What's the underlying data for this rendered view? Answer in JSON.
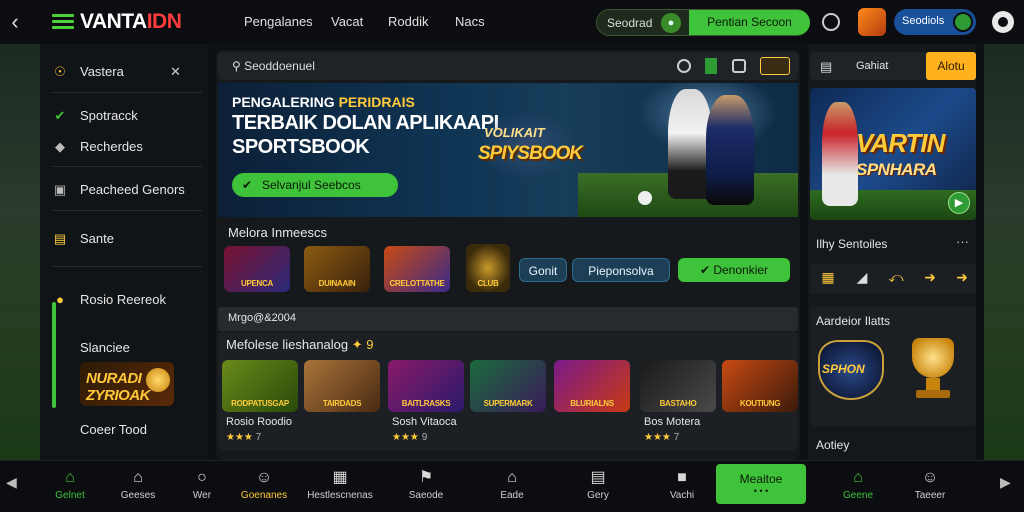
{
  "topbar": {
    "brand_main": "VANTA",
    "brand_accent": "IDN",
    "nav": [
      "Pengalanes",
      "Vacat",
      "Roddik",
      "Nacs"
    ],
    "search_label": "Seodrad",
    "search_cta": "Pentian Secoon",
    "account_label": "Seodiols",
    "icons": [
      "back-arrow-icon",
      "menu-icon",
      "clock-icon",
      "trophy-icon",
      "settings-icon"
    ]
  },
  "sidebar": {
    "items": [
      {
        "label": "Vastera",
        "icon": "ball-icon"
      },
      {
        "label": "Spotracck",
        "icon": "check-circle-icon"
      },
      {
        "label": "Recherdes",
        "icon": "diamond-icon"
      },
      {
        "label": "Peacheed Genors",
        "icon": "box-icon"
      },
      {
        "label": "Sante",
        "icon": "folder-icon"
      },
      {
        "label": "Rosio Reereok",
        "icon": "coin-icon"
      },
      {
        "label": "Slanciee",
        "icon": "star-icon"
      },
      {
        "label": "Coeer Tood",
        "icon": "list-icon"
      }
    ],
    "promo_text": "NURADI ZYRIOAK"
  },
  "main": {
    "search_query": "Seoddoenuel",
    "hero": {
      "kicker": "PENGALERING",
      "kicker_accent": "PERIDRAIS",
      "headline_1": "TERBAIK DOLAN APLIKAAPI",
      "headline_2": "SPORTSBOOK",
      "cta": "Selvanjul Seebcos",
      "emblem_top": "VOLIKAIT",
      "emblem_bottom": "SPIYSBOOK"
    },
    "featured": {
      "title": "Melora Inmeescs",
      "thumbs": [
        "UPENCA",
        "DUINAAIN",
        "CRELOTTATHE",
        "CLUB"
      ],
      "chips": [
        "Gonit",
        "Pieponsolva",
        "Denonkier"
      ]
    },
    "strip_label": "Mrgo@&2004",
    "games": {
      "title": "Mefolese lieshanalog",
      "count": "9",
      "items": [
        {
          "thumb": "RODPATUSGAP",
          "name": "Rosio Roodio",
          "rating": "7"
        },
        {
          "thumb": "TAIRDADS",
          "name": "",
          "rating": ""
        },
        {
          "thumb": "BAITLRASKS",
          "name": "Sosh Vitaoca",
          "rating": "9"
        },
        {
          "thumb": "SUPERMARK",
          "name": "",
          "rating": ""
        },
        {
          "thumb": "BLURIALNS",
          "name": "",
          "rating": ""
        },
        {
          "thumb": "BASTAHO",
          "name": "Bos Motera",
          "rating": "7"
        },
        {
          "thumb": "KOUTIUNG",
          "name": "",
          "rating": ""
        }
      ]
    }
  },
  "right": {
    "login_label": "Gahiat",
    "login_button": "Alotu",
    "promo_line_1": "VARTIN",
    "promo_line_2": "SPNHARA",
    "section_1": "Ilhy Sentoiles",
    "section_2": "Aardeior Ilatts",
    "section_3": "Aotiey",
    "trophy_text": "SPHON"
  },
  "bottombar": {
    "items": [
      {
        "label": "Gelnet",
        "icon": "home-icon",
        "active": true
      },
      {
        "label": "Geeses",
        "icon": "house-icon"
      },
      {
        "label": "Wer",
        "icon": "ball-icon"
      },
      {
        "label": "Goenanes",
        "icon": "user-icon"
      },
      {
        "label": "Hestlescnenas",
        "icon": "grid-icon"
      },
      {
        "label": "Saeode",
        "icon": "gift-icon"
      },
      {
        "label": "Eade",
        "icon": "house-icon"
      },
      {
        "label": "Gery",
        "icon": "doc-icon"
      },
      {
        "label": "Vachi",
        "icon": "square-icon"
      },
      {
        "label": "Geene",
        "icon": "home-icon",
        "active": true
      },
      {
        "label": "Taeeer",
        "icon": "user-icon"
      }
    ],
    "cta_line_1": "Meaitoe",
    "cta_line_2": "• • •"
  },
  "colors": {
    "accent_green": "#3fc33a",
    "accent_gold": "#ffcb3b",
    "brand_red": "#ff3b3b",
    "primary_blue": "#1a4f9a"
  }
}
